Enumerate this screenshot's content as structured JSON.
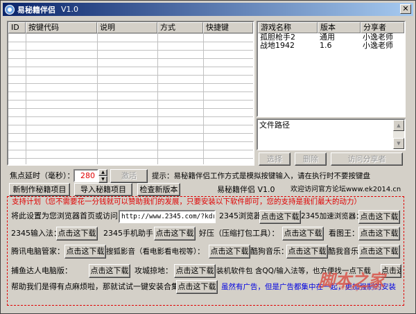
{
  "window": {
    "title": "易秘籍伴侣",
    "version": "V1.0"
  },
  "left_table": {
    "columns": [
      "ID",
      "按键代码",
      "说明",
      "方式",
      "快捷键"
    ]
  },
  "game_table": {
    "columns": [
      "游戏名称",
      "版本",
      "分享者"
    ],
    "rows": [
      {
        "name": "孤胆枪手2",
        "version": "通用",
        "sharer": "小逸老师"
      },
      {
        "name": "战地1942",
        "version": "1.6",
        "sharer": "小逸老师"
      }
    ]
  },
  "file_path_label": "文件路径",
  "right_buttons": {
    "select": "选择",
    "delete": "删除",
    "visit": "访问分享者"
  },
  "delay": {
    "label": "焦点延时（毫秒）：",
    "value": "280",
    "activate": "激活"
  },
  "tip": "提示：易秘籍伴侣工作方式是模拟按键输入，请在执行时不要按键盘",
  "toolbar": {
    "new": "新制作秘籍项目",
    "import": "导入秘籍项目",
    "check": "检查新版本"
  },
  "app_info": "易秘籍伴侣 V1.0",
  "forum": "欢迎访问官方论坛www.ek2014.cn",
  "support_plan": "支持计划（您不需要花一分钱就可以赞助我们的发展，只要安装以下软件即可，您的支持是我们最大的动力）",
  "homepage": {
    "label": "将此设置为您浏览器首页或访问：",
    "url": "http://www.2345.com/?kdreg"
  },
  "download_label": "点击这下载",
  "software": {
    "browser2345": "2345浏览器：",
    "browser2345_fast": "2345加速浏览器：",
    "input2345": "2345输入法：",
    "phone2345": "2345手机助手：",
    "haozip": "好压（压缩打包工具）：",
    "kantu": "看图王：",
    "tencent": "腾讯电脑管家：",
    "sohu": "搜狐影音（看电影看电视等）：",
    "kugou": "酷狗音乐：",
    "kuwo": "酷我音乐",
    "fishing": "捕鱼达人电脑版：",
    "gongcheng": "攻城掠地：",
    "pack": "装机软件包 含QQ/输入法等，也方便找一点下载"
  },
  "help": {
    "label": "帮助我们是得有点麻烦啦，那就试试一键安装合集："
  },
  "ad_note": "虽然有广告，但是广告都集中在一起，更加强制的安装",
  "watermark": {
    "main": "脚本之家",
    "sub": "www.jb51.net"
  },
  "colors": {
    "title_start": "#0a246a",
    "title_end": "#a6caf0",
    "accent_red": "#e00000",
    "link_blue": "#0000e0"
  }
}
